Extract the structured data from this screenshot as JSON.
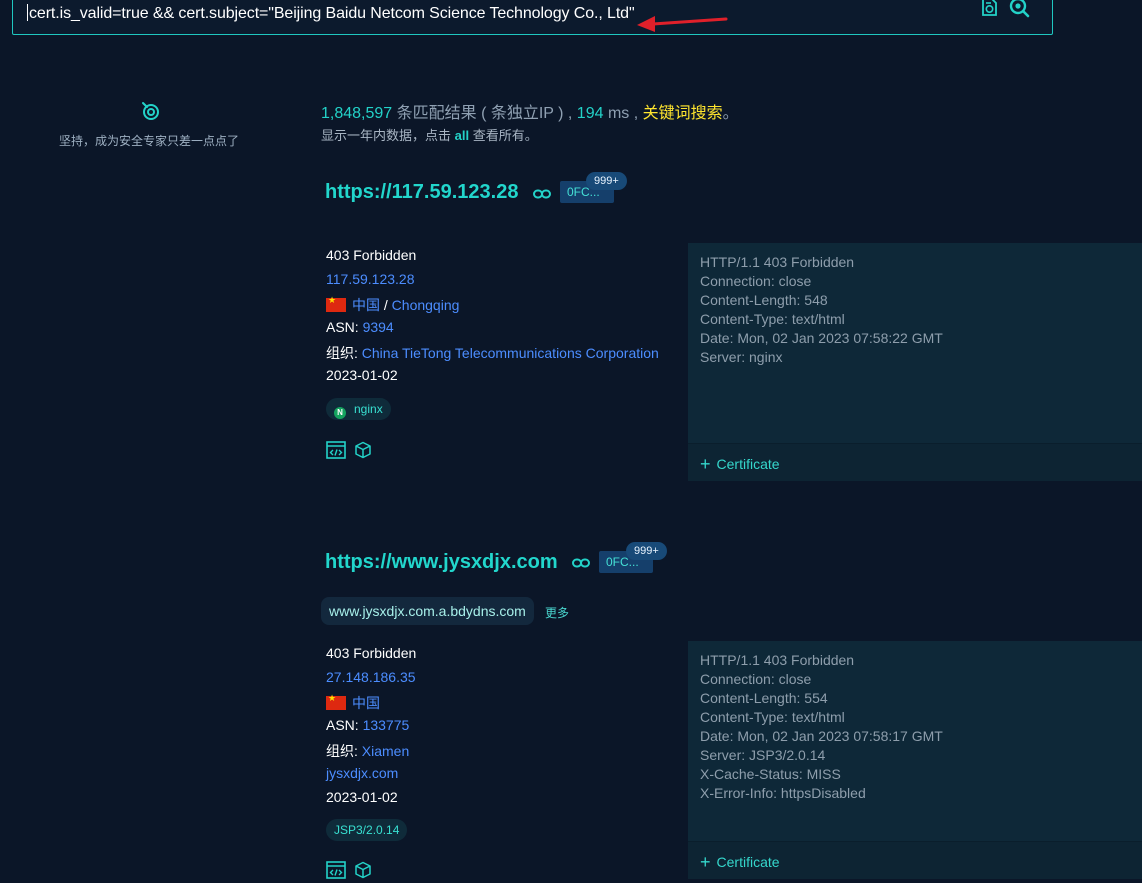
{
  "search": {
    "query": "cert.is_valid=true && cert.subject=\"Beijing Baidu Netcom Science Technology Co., Ltd\""
  },
  "sidebar": {
    "slogan": "坚持，成为安全专家只差一点点了"
  },
  "summary": {
    "count": "1,848,597",
    "matched_text": " 条匹配结果 ( 条独立IP ) , ",
    "ms_value": "194",
    "ms_text": " ms , ",
    "keyword_search": "关键词搜索",
    "period": "。",
    "sub_prefix": "显示一年内数据，点击 ",
    "sub_all": "all",
    "sub_suffix": " 查看所有。"
  },
  "results": [
    {
      "url": "https://117.59.123.28",
      "fc_badge": "0FC...",
      "count_badge": "999+",
      "title": "403 Forbidden",
      "ip": "117.59.123.28",
      "country": "中国",
      "separator": " / ",
      "city": "Chongqing",
      "asn_label": "ASN: ",
      "asn": "9394",
      "org_label": "组织: ",
      "org": "China TieTong Telecommunications Corporation",
      "date": "2023-01-02",
      "tag": "nginx",
      "header": "HTTP/1.1 403 Forbidden\nConnection: close\nContent-Length: 548\nContent-Type: text/html\nDate: Mon, 02 Jan 2023 07:58:22 GMT\nServer: nginx",
      "cert_label": "Certificate"
    },
    {
      "url": "https://www.jysxdjx.com",
      "fc_badge": "0FC...",
      "count_badge": "999+",
      "domain_chip": "www.jysxdjx.com.a.bdydns.com",
      "more": "更多",
      "title": "403 Forbidden",
      "ip": "27.148.186.35",
      "country": "中国",
      "asn_label": "ASN: ",
      "asn": "133775",
      "org_label": "组织: ",
      "org": "Xiamen",
      "domain": "jysxdjx.com",
      "date": "2023-01-02",
      "tag": "JSP3/2.0.14",
      "header": "HTTP/1.1 403 Forbidden\nConnection: close\nContent-Length: 554\nContent-Type: text/html\nDate: Mon, 02 Jan 2023 07:58:17 GMT\nServer: JSP3/2.0.14\nX-Cache-Status: MISS\nX-Error-Info: httpsDisabled",
      "cert_label": "Certificate"
    }
  ],
  "icons": [
    "cert-search-icon",
    "search-icon",
    "target-icon",
    "link-icon",
    "code-icon",
    "cube-icon",
    "plus-icon",
    "red-arrow-annotation"
  ],
  "colors": {
    "background": "#0b1628",
    "accent": "#23d2c8",
    "link_blue": "#4c8dff",
    "highlight_yellow": "#ffe52e",
    "annotation_red": "#e0202a"
  }
}
